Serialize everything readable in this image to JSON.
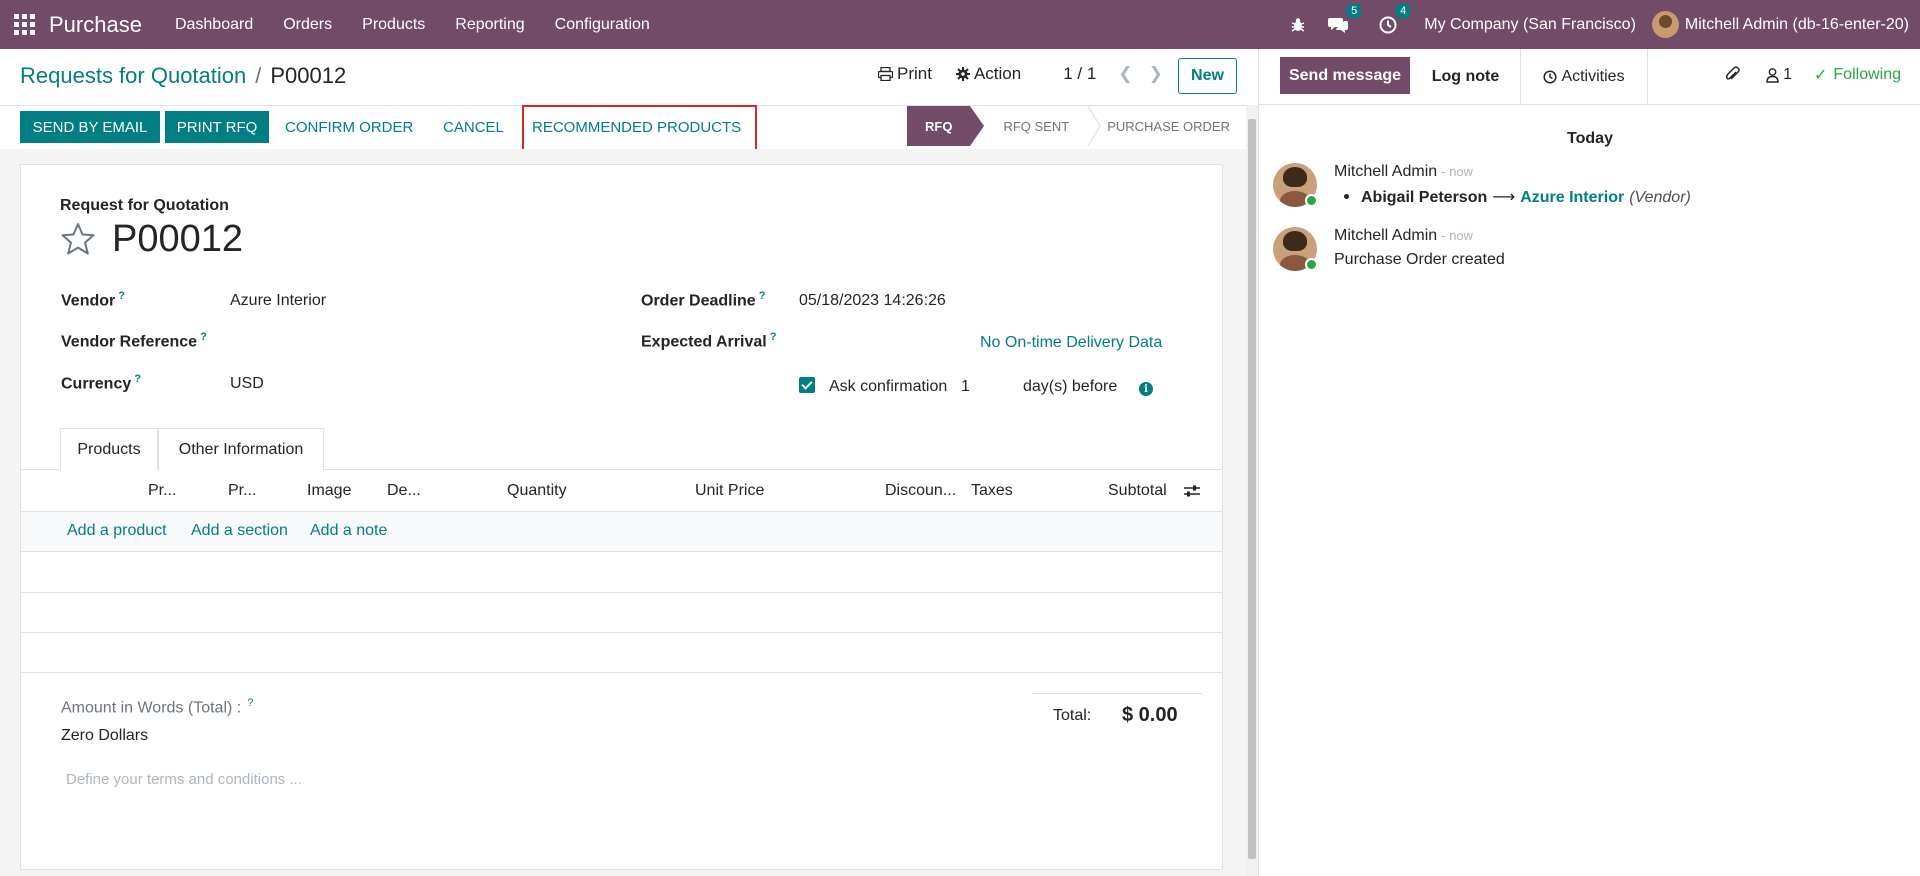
{
  "navbar": {
    "brand": "Purchase",
    "menu": [
      "Dashboard",
      "Orders",
      "Products",
      "Reporting",
      "Configuration"
    ],
    "messages_count": "5",
    "activities_count": "4",
    "company": "My Company (San Francisco)",
    "user": "Mitchell Admin (db-16-enter-20)"
  },
  "breadcrumb": {
    "parent": "Requests for Quotation",
    "separator": "/",
    "current": "P00012"
  },
  "control_panel": {
    "print": "Print",
    "action": "Action",
    "pager": "1 / 1",
    "new": "New"
  },
  "statusbar": {
    "buttons": {
      "send_email": "SEND BY EMAIL",
      "print_rfq": "PRINT RFQ",
      "confirm": "CONFIRM ORDER",
      "cancel": "CANCEL",
      "recommended": "RECOMMENDED PRODUCTS"
    },
    "stages": [
      "RFQ",
      "RFQ SENT",
      "PURCHASE ORDER"
    ],
    "active_stage": "RFQ"
  },
  "form": {
    "title_label": "Request for Quotation",
    "reference": "P00012",
    "vendor_label": "Vendor",
    "vendor": "Azure Interior",
    "vendor_ref_label": "Vendor Reference",
    "vendor_ref": "",
    "currency_label": "Currency",
    "currency": "USD",
    "deadline_label": "Order Deadline",
    "deadline": "05/18/2023 14:26:26",
    "arrival_label": "Expected Arrival",
    "delivery_data": "No On-time Delivery Data",
    "ask_confirmation_label": "Ask confirmation",
    "ask_confirmation_days": "1",
    "ask_confirmation_suffix": "day(s) before",
    "ask_confirmation_checked": true,
    "help_mark": "?"
  },
  "tabs": [
    "Products",
    "Other Information"
  ],
  "table": {
    "headers": [
      "Pr...",
      "Pr...",
      "Image",
      "De...",
      "Quantity",
      "Unit Price",
      "Discoun...",
      "Taxes",
      "Subtotal"
    ],
    "add_links": [
      "Add a product",
      "Add a section",
      "Add a note"
    ]
  },
  "footer": {
    "words_label": "Amount in Words (Total) :",
    "words_value": "Zero Dollars",
    "terms_placeholder": "Define your terms and conditions ...",
    "total_label": "Total:",
    "total_value": "$ 0.00"
  },
  "chatter": {
    "send_message": "Send message",
    "log_note": "Log note",
    "activities": "Activities",
    "followers_count": "1",
    "following": "Following",
    "date_separator": "Today",
    "messages": [
      {
        "author": "Mitchell Admin",
        "when": "- now",
        "old_value": "Abigail Peterson",
        "new_value": "Azure Interior",
        "field": "(Vendor)"
      },
      {
        "author": "Mitchell Admin",
        "when": "- now",
        "body": "Purchase Order created"
      }
    ]
  },
  "colors": {
    "brand": "#714b67",
    "accent": "#017e84",
    "highlight": "#e02424",
    "following": "#28a745"
  }
}
